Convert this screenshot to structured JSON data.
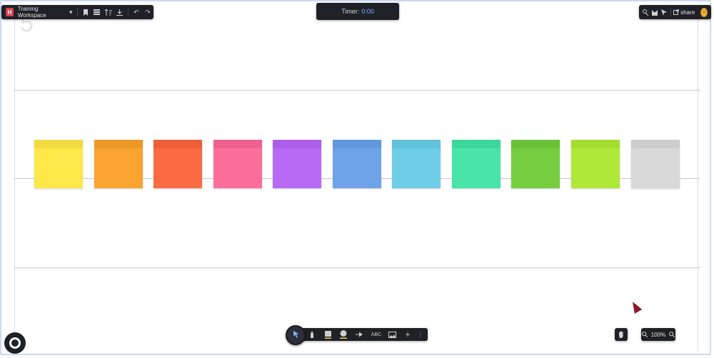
{
  "workspace": {
    "name": "Training Workspace",
    "background_digit": "5"
  },
  "toolbar_top_left": {
    "logo_text": "H",
    "icons": [
      "bookmark-icon",
      "list-icon",
      "sort-icon",
      "download-icon",
      "undo-icon",
      "redo-icon"
    ]
  },
  "timer": {
    "label": "Timer:",
    "value": "0:00"
  },
  "toolbar_top_right": {
    "share_label": "share",
    "icons": [
      "touch-icon",
      "cat-icon",
      "pointer-icon",
      "share-icon"
    ]
  },
  "sticky_notes": {
    "colors": [
      "#fde84a",
      "#f9a431",
      "#fb6b43",
      "#fd6e9b",
      "#b96af4",
      "#6ea3e8",
      "#6fcde8",
      "#48e4aa",
      "#76cd40",
      "#b0e83a",
      "#d9d9d9"
    ]
  },
  "bottom_toolbar": {
    "tools": [
      "select-icon",
      "pen-icon",
      "sticky-note-icon",
      "shape-icon",
      "arrow-icon",
      "text-tool",
      "image-icon",
      "add-icon",
      "more-icon"
    ],
    "text_tool_label": "ABC"
  },
  "zoom": {
    "value": "100%"
  }
}
